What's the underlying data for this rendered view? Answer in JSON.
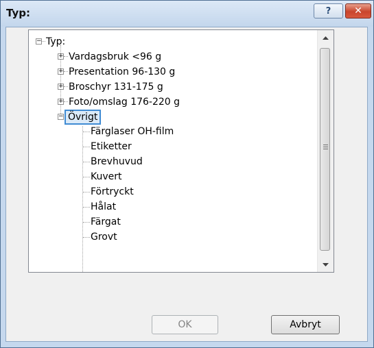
{
  "dialog": {
    "title": "Typ:",
    "help_label": "?",
    "close_label": "✕"
  },
  "tree": {
    "root_label": "Typ:",
    "items": [
      {
        "label": "Vardagsbruk <96 g",
        "expanded": false
      },
      {
        "label": "Presentation 96-130 g",
        "expanded": false
      },
      {
        "label": "Broschyr 131-175 g",
        "expanded": false
      },
      {
        "label": "Foto/omslag 176-220 g",
        "expanded": false
      },
      {
        "label": "Övrigt",
        "expanded": true,
        "selected": true
      }
    ],
    "children": [
      "Färglaser OH-film",
      "Etiketter",
      "Brevhuvud",
      "Kuvert",
      "Förtryckt",
      "Hålat",
      "Färgat",
      "Grovt"
    ]
  },
  "buttons": {
    "ok": "OK",
    "cancel": "Avbryt"
  },
  "colors": {
    "selection_border": "#3f8bd3",
    "selection_fill": "#dbeaf8",
    "close_button": "#c9452c"
  }
}
